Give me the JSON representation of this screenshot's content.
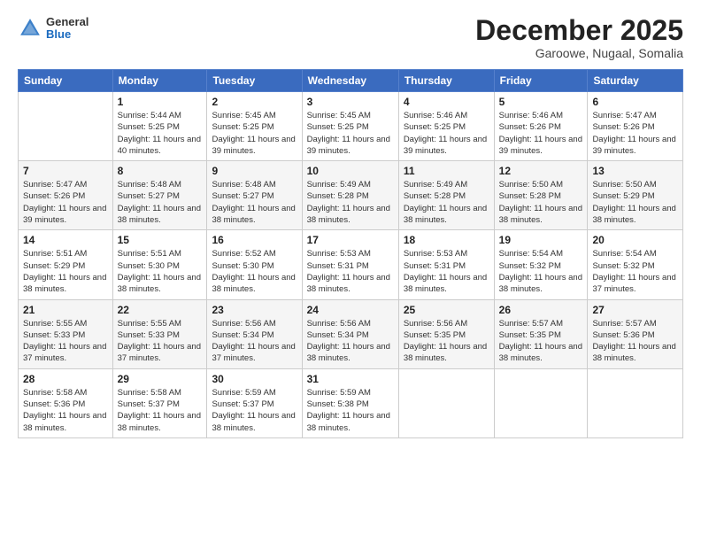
{
  "logo": {
    "general": "General",
    "blue": "Blue"
  },
  "title": {
    "month": "December 2025",
    "location": "Garoowe, Nugaal, Somalia"
  },
  "weekdays": [
    "Sunday",
    "Monday",
    "Tuesday",
    "Wednesday",
    "Thursday",
    "Friday",
    "Saturday"
  ],
  "weeks": [
    [
      {
        "day": "",
        "sunrise": "",
        "sunset": "",
        "daylight": ""
      },
      {
        "day": "1",
        "sunrise": "Sunrise: 5:44 AM",
        "sunset": "Sunset: 5:25 PM",
        "daylight": "Daylight: 11 hours and 40 minutes."
      },
      {
        "day": "2",
        "sunrise": "Sunrise: 5:45 AM",
        "sunset": "Sunset: 5:25 PM",
        "daylight": "Daylight: 11 hours and 39 minutes."
      },
      {
        "day": "3",
        "sunrise": "Sunrise: 5:45 AM",
        "sunset": "Sunset: 5:25 PM",
        "daylight": "Daylight: 11 hours and 39 minutes."
      },
      {
        "day": "4",
        "sunrise": "Sunrise: 5:46 AM",
        "sunset": "Sunset: 5:25 PM",
        "daylight": "Daylight: 11 hours and 39 minutes."
      },
      {
        "day": "5",
        "sunrise": "Sunrise: 5:46 AM",
        "sunset": "Sunset: 5:26 PM",
        "daylight": "Daylight: 11 hours and 39 minutes."
      },
      {
        "day": "6",
        "sunrise": "Sunrise: 5:47 AM",
        "sunset": "Sunset: 5:26 PM",
        "daylight": "Daylight: 11 hours and 39 minutes."
      }
    ],
    [
      {
        "day": "7",
        "sunrise": "Sunrise: 5:47 AM",
        "sunset": "Sunset: 5:26 PM",
        "daylight": "Daylight: 11 hours and 39 minutes."
      },
      {
        "day": "8",
        "sunrise": "Sunrise: 5:48 AM",
        "sunset": "Sunset: 5:27 PM",
        "daylight": "Daylight: 11 hours and 38 minutes."
      },
      {
        "day": "9",
        "sunrise": "Sunrise: 5:48 AM",
        "sunset": "Sunset: 5:27 PM",
        "daylight": "Daylight: 11 hours and 38 minutes."
      },
      {
        "day": "10",
        "sunrise": "Sunrise: 5:49 AM",
        "sunset": "Sunset: 5:28 PM",
        "daylight": "Daylight: 11 hours and 38 minutes."
      },
      {
        "day": "11",
        "sunrise": "Sunrise: 5:49 AM",
        "sunset": "Sunset: 5:28 PM",
        "daylight": "Daylight: 11 hours and 38 minutes."
      },
      {
        "day": "12",
        "sunrise": "Sunrise: 5:50 AM",
        "sunset": "Sunset: 5:28 PM",
        "daylight": "Daylight: 11 hours and 38 minutes."
      },
      {
        "day": "13",
        "sunrise": "Sunrise: 5:50 AM",
        "sunset": "Sunset: 5:29 PM",
        "daylight": "Daylight: 11 hours and 38 minutes."
      }
    ],
    [
      {
        "day": "14",
        "sunrise": "Sunrise: 5:51 AM",
        "sunset": "Sunset: 5:29 PM",
        "daylight": "Daylight: 11 hours and 38 minutes."
      },
      {
        "day": "15",
        "sunrise": "Sunrise: 5:51 AM",
        "sunset": "Sunset: 5:30 PM",
        "daylight": "Daylight: 11 hours and 38 minutes."
      },
      {
        "day": "16",
        "sunrise": "Sunrise: 5:52 AM",
        "sunset": "Sunset: 5:30 PM",
        "daylight": "Daylight: 11 hours and 38 minutes."
      },
      {
        "day": "17",
        "sunrise": "Sunrise: 5:53 AM",
        "sunset": "Sunset: 5:31 PM",
        "daylight": "Daylight: 11 hours and 38 minutes."
      },
      {
        "day": "18",
        "sunrise": "Sunrise: 5:53 AM",
        "sunset": "Sunset: 5:31 PM",
        "daylight": "Daylight: 11 hours and 38 minutes."
      },
      {
        "day": "19",
        "sunrise": "Sunrise: 5:54 AM",
        "sunset": "Sunset: 5:32 PM",
        "daylight": "Daylight: 11 hours and 38 minutes."
      },
      {
        "day": "20",
        "sunrise": "Sunrise: 5:54 AM",
        "sunset": "Sunset: 5:32 PM",
        "daylight": "Daylight: 11 hours and 37 minutes."
      }
    ],
    [
      {
        "day": "21",
        "sunrise": "Sunrise: 5:55 AM",
        "sunset": "Sunset: 5:33 PM",
        "daylight": "Daylight: 11 hours and 37 minutes."
      },
      {
        "day": "22",
        "sunrise": "Sunrise: 5:55 AM",
        "sunset": "Sunset: 5:33 PM",
        "daylight": "Daylight: 11 hours and 37 minutes."
      },
      {
        "day": "23",
        "sunrise": "Sunrise: 5:56 AM",
        "sunset": "Sunset: 5:34 PM",
        "daylight": "Daylight: 11 hours and 37 minutes."
      },
      {
        "day": "24",
        "sunrise": "Sunrise: 5:56 AM",
        "sunset": "Sunset: 5:34 PM",
        "daylight": "Daylight: 11 hours and 38 minutes."
      },
      {
        "day": "25",
        "sunrise": "Sunrise: 5:56 AM",
        "sunset": "Sunset: 5:35 PM",
        "daylight": "Daylight: 11 hours and 38 minutes."
      },
      {
        "day": "26",
        "sunrise": "Sunrise: 5:57 AM",
        "sunset": "Sunset: 5:35 PM",
        "daylight": "Daylight: 11 hours and 38 minutes."
      },
      {
        "day": "27",
        "sunrise": "Sunrise: 5:57 AM",
        "sunset": "Sunset: 5:36 PM",
        "daylight": "Daylight: 11 hours and 38 minutes."
      }
    ],
    [
      {
        "day": "28",
        "sunrise": "Sunrise: 5:58 AM",
        "sunset": "Sunset: 5:36 PM",
        "daylight": "Daylight: 11 hours and 38 minutes."
      },
      {
        "day": "29",
        "sunrise": "Sunrise: 5:58 AM",
        "sunset": "Sunset: 5:37 PM",
        "daylight": "Daylight: 11 hours and 38 minutes."
      },
      {
        "day": "30",
        "sunrise": "Sunrise: 5:59 AM",
        "sunset": "Sunset: 5:37 PM",
        "daylight": "Daylight: 11 hours and 38 minutes."
      },
      {
        "day": "31",
        "sunrise": "Sunrise: 5:59 AM",
        "sunset": "Sunset: 5:38 PM",
        "daylight": "Daylight: 11 hours and 38 minutes."
      },
      {
        "day": "",
        "sunrise": "",
        "sunset": "",
        "daylight": ""
      },
      {
        "day": "",
        "sunrise": "",
        "sunset": "",
        "daylight": ""
      },
      {
        "day": "",
        "sunrise": "",
        "sunset": "",
        "daylight": ""
      }
    ]
  ]
}
